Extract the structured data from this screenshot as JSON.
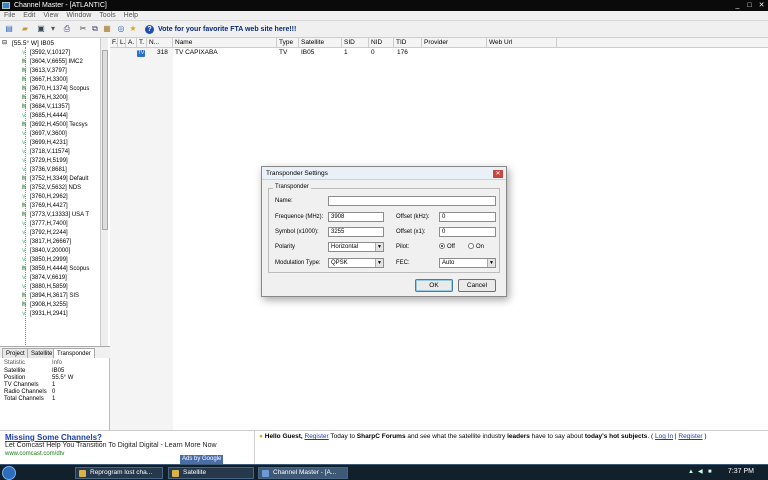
{
  "window": {
    "title": "Channel Master - [ATLANTIC]",
    "min": "_",
    "max": "□",
    "close": "✕"
  },
  "menu": [
    "File",
    "Edit",
    "View",
    "Window",
    "Tools",
    "Help"
  ],
  "toolbar": {
    "vote": "Vote for your favorite FTA web site here!!!"
  },
  "tree": {
    "root": "[55.5° W] IB05",
    "items": [
      {
        "label": "[3592,V,10127]",
        "tv": false
      },
      {
        "label": "[3604,V,6655] IMC2",
        "tv": true
      },
      {
        "label": "[3613,V,3797]",
        "tv": true
      },
      {
        "label": "[3667,H,3300]",
        "tv": true
      },
      {
        "label": "[3670,H,1374] Scopus",
        "tv": true
      },
      {
        "label": "[3676,H,3200]",
        "tv": true
      },
      {
        "label": "[3684,V,11357]",
        "tv": true
      },
      {
        "label": "[3685,H,4444]",
        "tv": false
      },
      {
        "label": "[3692,H,4500] Tecsys",
        "tv": true
      },
      {
        "label": "[3697,V,3600]",
        "tv": false
      },
      {
        "label": "[3699,H,4231]",
        "tv": false
      },
      {
        "label": "[3718,V,11574]",
        "tv": false
      },
      {
        "label": "[3729,H,5199]",
        "tv": false
      },
      {
        "label": "[3736,V,8681]",
        "tv": false
      },
      {
        "label": "[3752,H,3349] Default",
        "tv": true
      },
      {
        "label": "[3752,V,5632] NDS",
        "tv": true
      },
      {
        "label": "[3760,H,2962]",
        "tv": false
      },
      {
        "label": "[3769,H,4427]",
        "tv": true
      },
      {
        "label": "[3773,V,13333] USA T",
        "tv": true
      },
      {
        "label": "[3777,H,7400]",
        "tv": false
      },
      {
        "label": "[3792,H,2244]",
        "tv": false
      },
      {
        "label": "[3817,H,26667]",
        "tv": false
      },
      {
        "label": "[3840,V,20000]",
        "tv": false
      },
      {
        "label": "[3850,H,2999]",
        "tv": false
      },
      {
        "label": "[3859,H,4444] Scopus",
        "tv": true
      },
      {
        "label": "[3874,V,6619]",
        "tv": false
      },
      {
        "label": "[3880,H,5859]",
        "tv": false
      },
      {
        "label": "[3894,H,3617] SIS",
        "tv": true
      },
      {
        "label": "[3908,H,3255]",
        "tv": true
      },
      {
        "label": "[3931,H,2941]",
        "tv": false
      }
    ]
  },
  "panel_tabs": [
    "Project",
    "Satellite",
    "Transponder"
  ],
  "stats": {
    "head": [
      "Statistic",
      "Info"
    ],
    "rows": [
      [
        "Satellite",
        "IB05"
      ],
      [
        "Position",
        "55.5° W"
      ],
      [
        "TV Channels",
        "1"
      ],
      [
        "Radio Channels",
        "0"
      ],
      [
        "Total Channels",
        "1"
      ]
    ]
  },
  "list": {
    "columns": [
      "F.",
      "L.",
      "A.",
      "T.",
      "N...",
      "Name",
      "Type",
      "Satellite",
      "SID",
      "NID",
      "TID",
      "Provider",
      "Web Url"
    ],
    "rows": [
      {
        "badge": "TV",
        "num": "318",
        "name": "TV CAPIXABA",
        "type": "TV",
        "sat": "IB05",
        "sid": "1",
        "nid": "0",
        "tid": "176",
        "provider": "",
        "url": ""
      }
    ]
  },
  "dialog": {
    "title": "Transponder Settings",
    "group": "Transponder",
    "name_label": "Name:",
    "name_value": "",
    "freq_label": "Frequence (MHz):",
    "freq_value": "3908",
    "offk_label": "Offset (kHz):",
    "offk_value": "0",
    "sym_label": "Symbol (x1000):",
    "sym_value": "3255",
    "offx_label": "Offset (x1):",
    "offx_value": "0",
    "pol_label": "Polarity",
    "pol_value": "Horizontal",
    "pilot_label": "Pilot:",
    "pilot_off": "Off",
    "pilot_on": "On",
    "mod_label": "Modulation Type:",
    "mod_value": "QPSK",
    "fec_label": "FEC:",
    "fec_value": "Auto",
    "ok": "OK",
    "cancel": "Cancel"
  },
  "ad_left": {
    "title": "Missing Some Channels?",
    "line": "Let Comcast Help You Transition To Digital Digital - Learn More Now",
    "url": "www.comcast.com/dtv",
    "by": "Ads by Google"
  },
  "ad_right": {
    "hello": "Hello Guest,",
    "register": "Register",
    "t1": " Today to ",
    "forum": "SharpC Forums",
    "t2": " and see what the satellite industry ",
    "leaders": "leaders",
    "t3": " have to say about ",
    "hot": "today's hot subjects",
    "t4": ". ( ",
    "login": "Log In",
    "sep": " | ",
    "register2": "Register",
    "t5": " )"
  },
  "taskbar": {
    "items": [
      "Reprogram lost cha...",
      "Satellite",
      "Channel Master - [A..."
    ],
    "clock": "7:37 PM"
  }
}
